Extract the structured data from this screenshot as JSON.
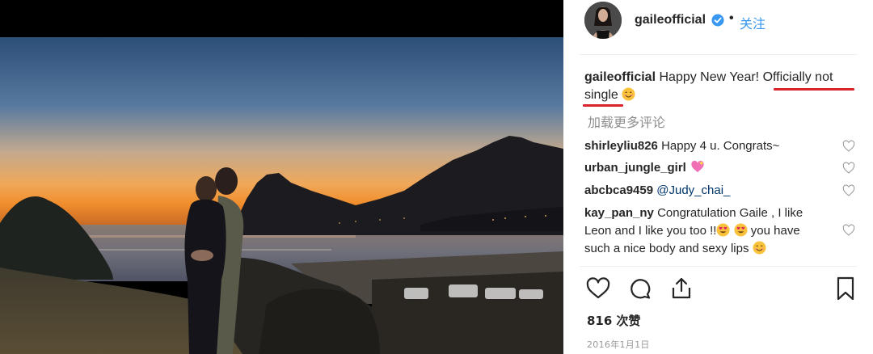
{
  "colors": {
    "accent_blue": "#3897f0",
    "underline_red": "#d9232c",
    "muted_gray": "#8e8e8e"
  },
  "post": {
    "username": "gaileofficial",
    "follow_label": "关注",
    "dot": "•",
    "verified_icon": "verified-badge-icon"
  },
  "caption": {
    "user": "gaileofficial",
    "text_before": "Happy New Year! ",
    "text_underlined_1": "Officially not",
    "text_underlined_2": "single",
    "emoji": "smiling-face-icon"
  },
  "load_more_label": "加载更多评论",
  "comments": [
    {
      "user": "shirleyliu826",
      "text": "Happy 4 u. Congrats~"
    },
    {
      "user": "urban_jungle_girl",
      "text": "",
      "emoji": "sparkling-heart-icon"
    },
    {
      "user": "abcbca9459",
      "text": "@Judy_chai_"
    },
    {
      "user": "kay_pan_ny",
      "line1": "Congratulation Gaile , I like",
      "line2a": "Leon and I like you too !!",
      "line2b": "you have",
      "line3": "such a nice body and sexy lips"
    }
  ],
  "actions": [
    "heart-icon",
    "comment-icon",
    "share-icon",
    "bookmark-icon"
  ],
  "likes_label": "816 次赞",
  "date": "2016年1月1日"
}
